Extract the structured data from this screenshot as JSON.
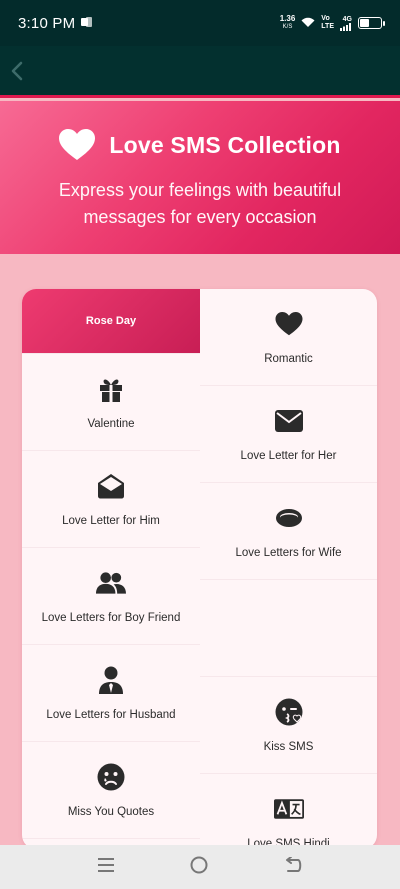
{
  "status_bar": {
    "time": "3:10 PM",
    "net_speed": "1.36",
    "net_unit": "K/S",
    "volte_top": "Vo",
    "volte_bottom": "LTE",
    "network": "4G",
    "battery_level": 0.4
  },
  "app_bar": {
    "back_icon": "chevron-left-icon"
  },
  "hero": {
    "icon": "heart-icon",
    "title": "Love SMS Collection",
    "subtitle": "Express your feelings with beautiful messages for every occasion"
  },
  "categories": [
    {
      "label": "Rose Day",
      "icon": "",
      "selected": true
    },
    {
      "label": "Romantic",
      "icon": "heart-icon"
    },
    {
      "label": "Valentine",
      "icon": "gift-icon"
    },
    {
      "label": "Love Letter for Her",
      "icon": "envelope-icon"
    },
    {
      "label": "Love Letter for Him",
      "icon": "envelope-open-icon"
    },
    {
      "label": "Love Letters for Wife",
      "icon": "ring-icon"
    },
    {
      "label": "Love Letters for Boy Friend",
      "icon": "users-icon"
    },
    {
      "label": "",
      "icon": ""
    },
    {
      "label": "Love Letters for Husband",
      "icon": "user-tie-icon"
    },
    {
      "label": "Kiss SMS",
      "icon": "kiss-face-icon"
    },
    {
      "label": "Miss You Quotes",
      "icon": "sad-tear-icon"
    },
    {
      "label": "Love SMS Hindi",
      "icon": "language-icon"
    }
  ],
  "nav_bar": {
    "recents": "recents-icon",
    "home": "home-icon",
    "back": "back-icon"
  },
  "colors": {
    "accent": "#e0194f",
    "dark": "#03302f",
    "page_bg": "#f7b8c2"
  }
}
